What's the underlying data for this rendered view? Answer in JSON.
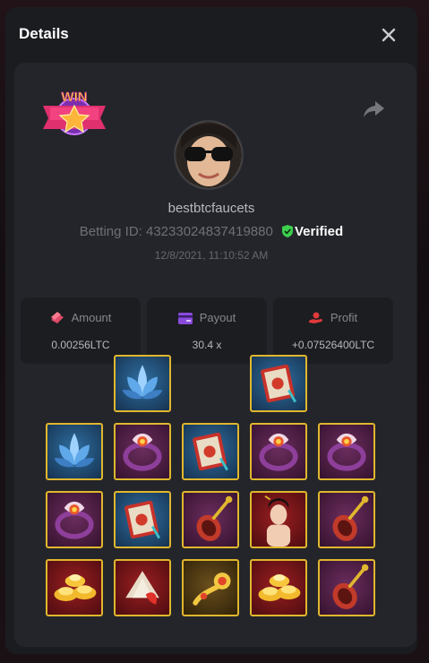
{
  "modal": {
    "title": "Details"
  },
  "player": {
    "username": "bestbtcfaucets",
    "betting_id_label": "Betting ID:",
    "betting_id": "43233024837419880",
    "verified_label": "Verified",
    "timestamp": "12/8/2021, 11:10:52 AM",
    "win_badge_text": "WIN"
  },
  "stats": [
    {
      "label": "Amount",
      "value": "0.00256LTC",
      "icon": "coin-stack-icon",
      "color": "#e04a6a"
    },
    {
      "label": "Payout",
      "value": "30.4 x",
      "icon": "card-icon",
      "color": "#8a4bdd"
    },
    {
      "label": "Profit",
      "value": "+0.07526400LTC",
      "icon": "hand-coin-icon",
      "color": "#e03a3a"
    }
  ],
  "reels": [
    [
      "blue-lotus",
      "purple-ring",
      "gold-ingots"
    ],
    [
      "blue-lotus",
      "purple-ring",
      "red-scroll",
      "paper-fan"
    ],
    [
      "red-scroll",
      "pipa-lute",
      "golden-ruyi"
    ],
    [
      "red-scroll",
      "purple-ring",
      "lady-portrait",
      "gold-ingots"
    ],
    [
      "purple-ring",
      "pipa-lute",
      "pipa-lute"
    ]
  ],
  "colors": {
    "accent_gold": "#e0b72e",
    "verified_green": "#3ccf4e",
    "panel": "#24252a"
  }
}
